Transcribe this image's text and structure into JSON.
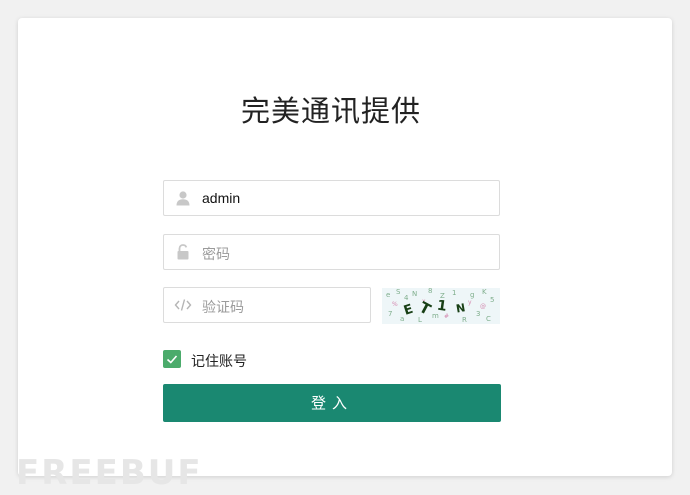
{
  "form": {
    "title": "完美通讯提供",
    "username": {
      "value": "admin",
      "icon": "user-icon"
    },
    "password": {
      "placeholder": "密码",
      "icon": "lock-icon"
    },
    "captcha": {
      "placeholder": "验证码",
      "icon": "code-icon",
      "image_text": "ET1N"
    },
    "remember": {
      "label": "记住账号",
      "checked": true
    },
    "submit_label": "登入"
  },
  "watermark": {
    "text": "FREEBUF"
  },
  "colors": {
    "primary": "#1a8871",
    "checkbox": "#4bab6b",
    "border": "#dcdcdc",
    "background": "#f1f1f1"
  }
}
